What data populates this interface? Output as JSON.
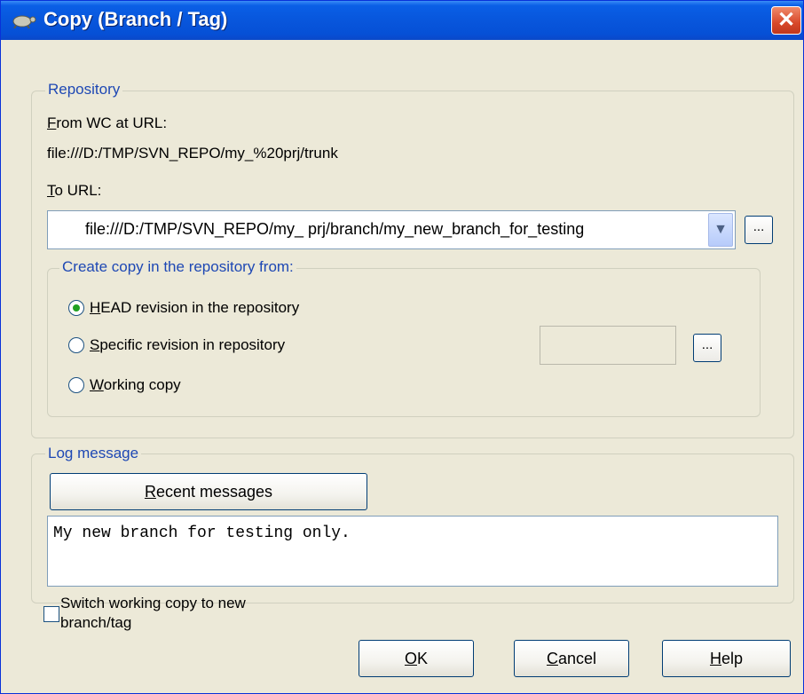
{
  "window": {
    "title": "Copy (Branch / Tag)",
    "close_glyph": "✕"
  },
  "repository": {
    "group_label": "Repository",
    "from_label": {
      "mnemonic": "F",
      "rest": "rom WC at URL:"
    },
    "from_url": "file:///D:/TMP/SVN_REPO/my_%20prj/trunk",
    "to_label": {
      "mnemonic": "T",
      "rest": "o URL:"
    },
    "to_url": "file:///D:/TMP/SVN_REPO/my_ prj/branch/my_new_branch_for_testing",
    "browse_label": "...",
    "copy_from": {
      "group_label": "Create copy in the repository from:",
      "options": [
        {
          "mnemonic": "H",
          "rest": "EAD revision in the repository",
          "selected": true
        },
        {
          "mnemonic": "S",
          "rest": "pecific revision in repository",
          "selected": false
        },
        {
          "mnemonic": "W",
          "rest": "orking copy",
          "selected": false
        }
      ],
      "revision_value": "",
      "browse_label": "..."
    }
  },
  "log": {
    "group_label": "Log message",
    "recent_button": {
      "mnemonic": "R",
      "rest": "ecent messages"
    },
    "message": "My new branch for testing only."
  },
  "switch_checkbox": {
    "label_line1": "Switch working copy to new",
    "label_line2": "branch/tag",
    "checked": false
  },
  "buttons": {
    "ok": {
      "mnemonic": "O",
      "rest": "K"
    },
    "cancel": {
      "mnemonic": "C",
      "rest": "ancel"
    },
    "help": {
      "mnemonic": "H",
      "rest": "elp"
    }
  },
  "colors": {
    "titlebar": "#0856dc",
    "dialog_bg": "#ece9d8",
    "group_label": "#1e48b4",
    "radio_dot": "#21a121"
  }
}
